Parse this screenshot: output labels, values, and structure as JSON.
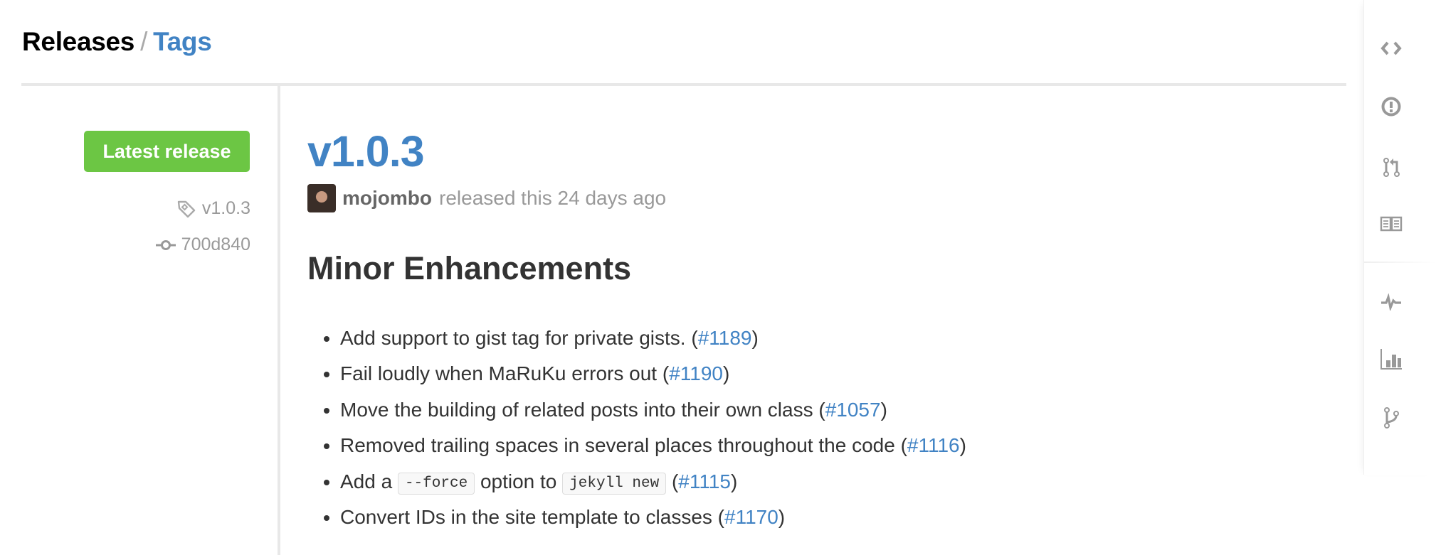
{
  "header": {
    "releases_label": "Releases",
    "separator": "/",
    "tags_label": "Tags"
  },
  "sidebar": {
    "latest_badge": "Latest release",
    "tag_name": "v1.0.3",
    "commit_sha": "700d840"
  },
  "release": {
    "title": "v1.0.3",
    "author": "mojombo",
    "released_text": "released this 24 days ago",
    "section_heading": "Minor Enhancements",
    "notes": [
      {
        "text": "Add support to gist tag for private gists. (",
        "issue": "#1189",
        "after": ")"
      },
      {
        "text": "Fail loudly when MaRuKu errors out (",
        "issue": "#1190",
        "after": ")"
      },
      {
        "text": "Move the building of related posts into their own class (",
        "issue": "#1057",
        "after": ")"
      },
      {
        "text": "Removed trailing spaces in several places throughout the code (",
        "issue": "#1116",
        "after": ")"
      },
      {
        "text_a": "Add a ",
        "code_a": "--force",
        "text_b": " option to ",
        "code_b": "jekyll new",
        "text_c": " (",
        "issue": "#1115",
        "after": ")"
      },
      {
        "text": "Convert IDs in the site template to classes (",
        "issue": "#1170",
        "after": ")"
      }
    ]
  },
  "repo_nav": {
    "items": [
      {
        "icon": "code-icon",
        "label": "Code"
      },
      {
        "icon": "issue-icon",
        "label": "Issues"
      },
      {
        "icon": "pull-request-icon",
        "label": "Pull Requests"
      },
      {
        "icon": "wiki-icon",
        "label": "Wiki"
      },
      {
        "icon": "pulse-icon",
        "label": "Pulse"
      },
      {
        "icon": "graph-icon",
        "label": "Graphs"
      },
      {
        "icon": "network-icon",
        "label": "Network"
      }
    ]
  },
  "colors": {
    "link": "#4183c4",
    "badge": "#6cc644",
    "muted": "#999999",
    "icon": "#999999"
  }
}
